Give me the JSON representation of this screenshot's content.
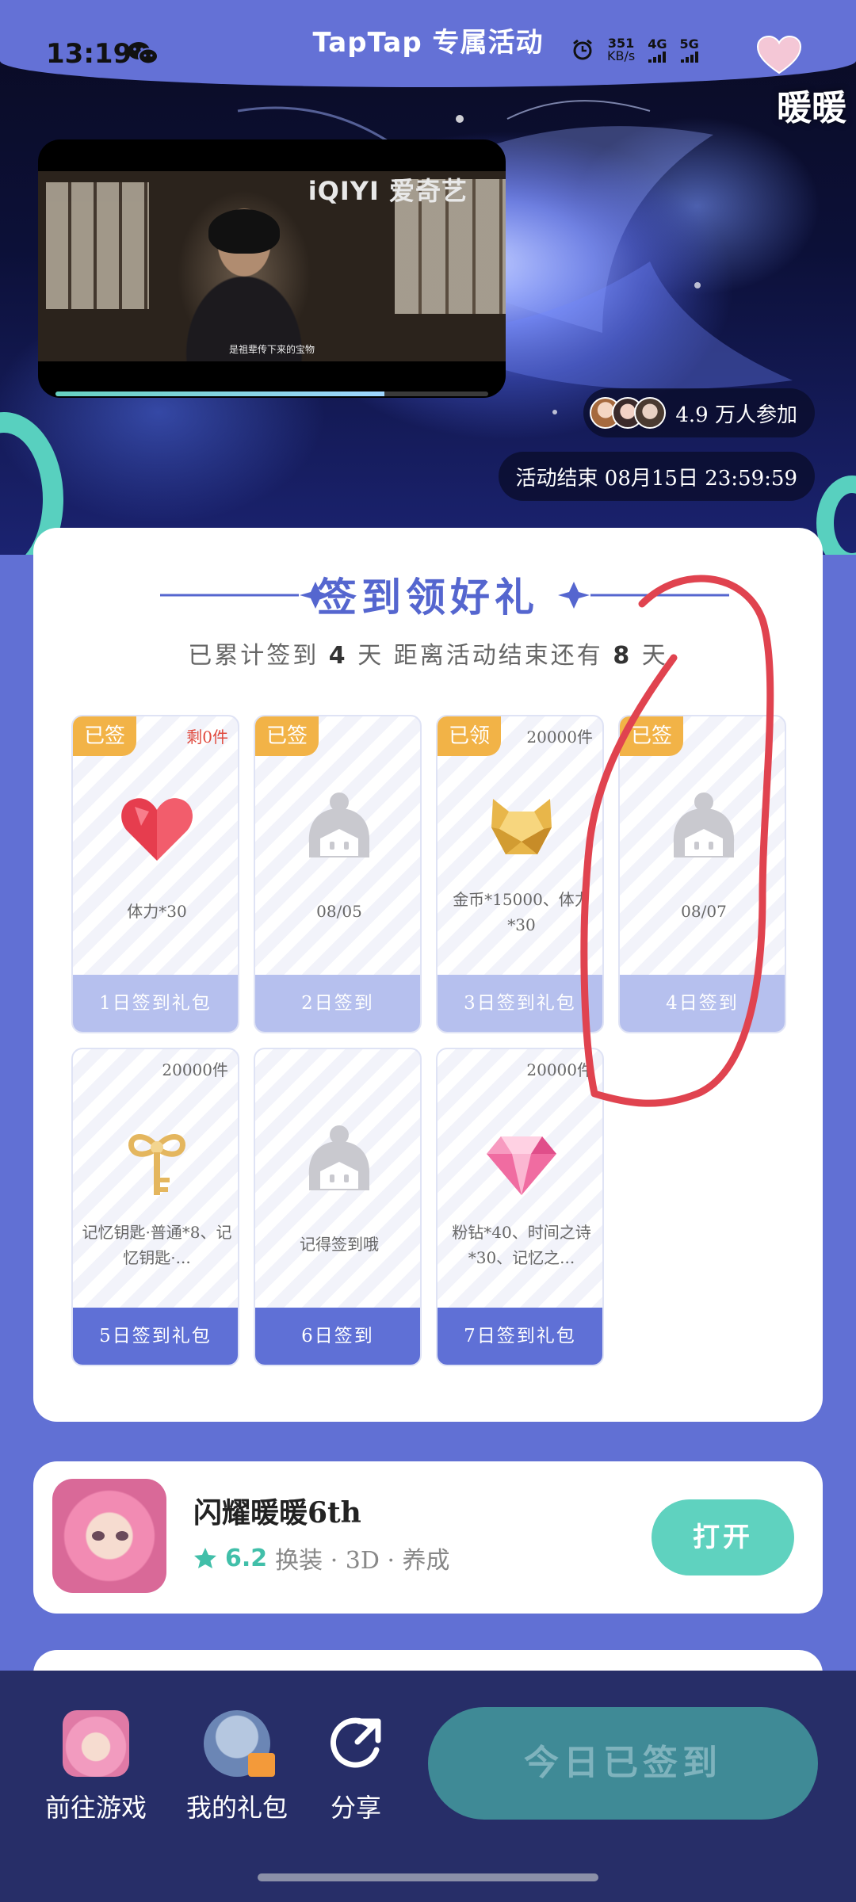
{
  "status_bar": {
    "time": "13:19",
    "net_speed_value": "351",
    "net_speed_unit": "KB/s",
    "sig1": "4G",
    "sig2": "5G"
  },
  "header": {
    "title": "TapTap 专属活动"
  },
  "hero": {
    "game_logo": "暖暖",
    "video_watermark": "iQIYI 爱奇艺",
    "video_subtitle": "是祖辈传下来的宝物",
    "video_progress": 0.76,
    "participants": "4.9 万人参加",
    "end_time": "活动结束 08月15日 23:59:59"
  },
  "checkin": {
    "title": "签到领好礼",
    "sub_prefix": "已累计签到",
    "sub_days": "4",
    "sub_middle": "天  距离活动结束还有",
    "sub_remaining": "8",
    "sub_suffix": "天",
    "tiles": [
      {
        "badge": "已签",
        "count": "剩0件",
        "desc": "体力*30",
        "footer": "1日签到礼包",
        "icon": "heart-icon"
      },
      {
        "badge": "已签",
        "count": "",
        "desc": "08/05",
        "footer": "2日签到",
        "icon": "placeholder-character-icon"
      },
      {
        "badge": "已领",
        "count": "20000件",
        "desc": "金币*15000、体力*30",
        "footer": "3日签到礼包",
        "icon": "gold-coin-icon"
      },
      {
        "badge": "已签",
        "count": "",
        "desc": "08/07",
        "footer": "4日签到",
        "icon": "placeholder-character-icon"
      },
      {
        "badge": "",
        "count": "20000件",
        "desc": "记忆钥匙·普通*8、记忆钥匙·...",
        "footer": "5日签到礼包",
        "icon": "key-icon"
      },
      {
        "badge": "",
        "count": "",
        "desc": "记得签到哦",
        "footer": "6日签到",
        "icon": "placeholder-character-icon"
      },
      {
        "badge": "",
        "count": "20000件",
        "desc": "粉钻*40、时间之诗*30、记忆之...",
        "footer": "7日签到礼包",
        "icon": "pink-diamond-icon"
      }
    ]
  },
  "game": {
    "name": "闪耀暖暖6th",
    "rating": "6.2",
    "tags": "换装 · 3D · 养成",
    "open_label": "打开"
  },
  "bottom_bar": {
    "go_game": "前往游戏",
    "my_gifts": "我的礼包",
    "share": "分享",
    "signed_label": "今日已签到"
  },
  "colors": {
    "accent": "#5566cf",
    "teal": "#5fd2bf",
    "badge_orange": "#f2b347",
    "annotation_red": "#e0434f"
  }
}
